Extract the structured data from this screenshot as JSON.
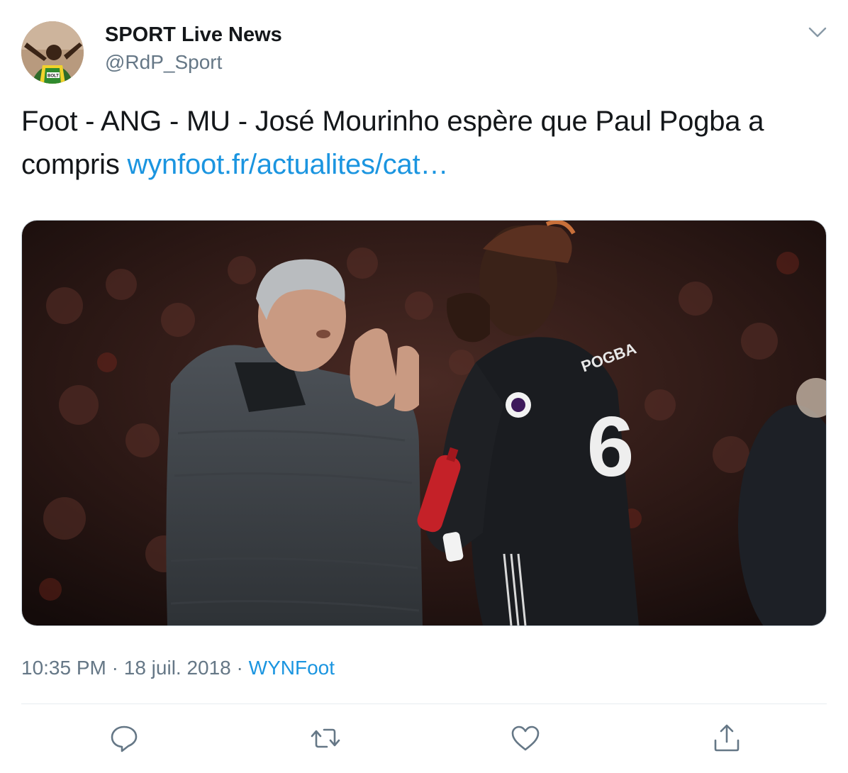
{
  "author": {
    "display_name": "SPORT Live News",
    "handle": "@RdP_Sport",
    "avatar_badge": "BOLT"
  },
  "tweet": {
    "text": "Foot - ANG - MU - José Mourinho espère que Paul Pogba a compris ",
    "link_text": "wynfoot.fr/actualites/cat…"
  },
  "media": {
    "jersey_name": "POGBA",
    "jersey_number": "6"
  },
  "meta": {
    "time": "10:35 PM",
    "separator1": " · ",
    "date": "18 juil. 2018",
    "separator2": " · ",
    "source": "WYNFoot"
  },
  "icons": {
    "menu": "chevron-down-icon",
    "reply": "reply-icon",
    "retweet": "retweet-icon",
    "like": "heart-icon",
    "share": "share-icon"
  },
  "colors": {
    "link": "#1b95e0",
    "secondary_text": "#657786",
    "primary_text": "#14171a",
    "divider": "#e6ecf0"
  }
}
